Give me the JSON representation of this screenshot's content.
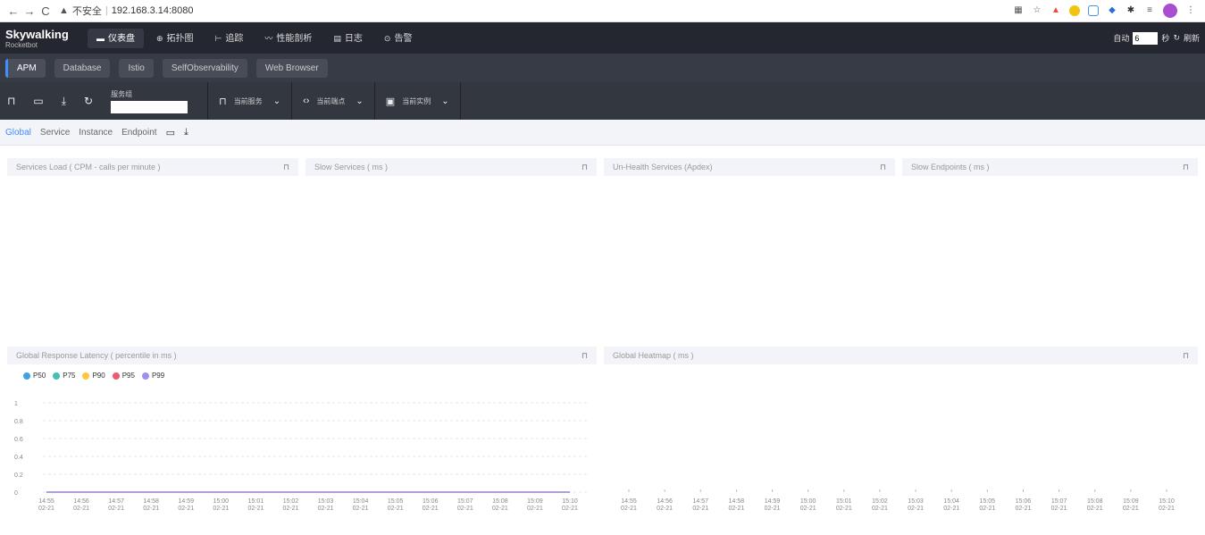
{
  "browser": {
    "back": "←",
    "forward": "→",
    "reload": "C",
    "warning": "▲",
    "insecure_label": "不安全",
    "separator": "|",
    "url": "192.168.3.14:8080"
  },
  "header": {
    "logo_main": "Skywalking",
    "logo_sub": "Rocketbot",
    "nav": [
      {
        "label": "仪表盘",
        "icon": "▬"
      },
      {
        "label": "拓扑图",
        "icon": "⊕"
      },
      {
        "label": "追踪",
        "icon": "⊢"
      },
      {
        "label": "性能剖析",
        "icon": "〰"
      },
      {
        "label": "日志",
        "icon": "▤"
      },
      {
        "label": "告警",
        "icon": "⊙"
      }
    ],
    "auto_label": "自动",
    "auto_value": "6",
    "seconds_label": "秒",
    "refresh_label": "刷新",
    "refresh_icon": "↻"
  },
  "layers": [
    "APM",
    "Database",
    "Istio",
    "SelfObservability",
    "Web Browser"
  ],
  "toolbar": {
    "service_group_label": "服务组",
    "current_service": "当前服务",
    "current_endpoint": "当前端点",
    "current_instance": "当前实例"
  },
  "sub_tabs": [
    "Global",
    "Service",
    "Instance",
    "Endpoint"
  ],
  "panels": {
    "services_load": "Services Load ( CPM - calls per minute )",
    "slow_services": "Slow Services ( ms )",
    "unhealth_services": "Un-Health Services (Apdex)",
    "slow_endpoints": "Slow Endpoints ( ms )",
    "global_latency": "Global Response Latency ( percentile in ms )",
    "global_heatmap": "Global Heatmap ( ms )"
  },
  "chart_data": [
    {
      "type": "line",
      "title": "Global Response Latency ( percentile in ms )",
      "categories": [
        "14:55\n02-21",
        "14:56\n02-21",
        "14:57\n02-21",
        "14:58\n02-21",
        "14:59\n02-21",
        "15:00\n02-21",
        "15:01\n02-21",
        "15:02\n02-21",
        "15:03\n02-21",
        "15:04\n02-21",
        "15:05\n02-21",
        "15:06\n02-21",
        "15:07\n02-21",
        "15:08\n02-21",
        "15:09\n02-21",
        "15:10\n02-21"
      ],
      "x_times": [
        "14:55",
        "14:56",
        "14:57",
        "14:58",
        "14:59",
        "15:00",
        "15:01",
        "15:02",
        "15:03",
        "15:04",
        "15:05",
        "15:06",
        "15:07",
        "15:08",
        "15:09",
        "15:10"
      ],
      "x_dates": [
        "02-21",
        "02-21",
        "02-21",
        "02-21",
        "02-21",
        "02-21",
        "02-21",
        "02-21",
        "02-21",
        "02-21",
        "02-21",
        "02-21",
        "02-21",
        "02-21",
        "02-21",
        "02-21"
      ],
      "y_ticks": [
        "0",
        "0.2",
        "0.4",
        "0.6",
        "0.8",
        "1"
      ],
      "ylim": [
        0,
        1
      ],
      "series": [
        {
          "name": "P50",
          "color": "#3fa1e6",
          "values": [
            0,
            0,
            0,
            0,
            0,
            0,
            0,
            0,
            0,
            0,
            0,
            0,
            0,
            0,
            0,
            0
          ]
        },
        {
          "name": "P75",
          "color": "#3fc1b8",
          "values": [
            0,
            0,
            0,
            0,
            0,
            0,
            0,
            0,
            0,
            0,
            0,
            0,
            0,
            0,
            0,
            0
          ]
        },
        {
          "name": "P90",
          "color": "#ffc53d",
          "values": [
            0,
            0,
            0,
            0,
            0,
            0,
            0,
            0,
            0,
            0,
            0,
            0,
            0,
            0,
            0,
            0
          ]
        },
        {
          "name": "P95",
          "color": "#f05a6e",
          "values": [
            0,
            0,
            0,
            0,
            0,
            0,
            0,
            0,
            0,
            0,
            0,
            0,
            0,
            0,
            0,
            0
          ]
        },
        {
          "name": "P99",
          "color": "#a18ff0",
          "values": [
            0,
            0,
            0,
            0,
            0,
            0,
            0,
            0,
            0,
            0,
            0,
            0,
            0,
            0,
            0,
            0
          ]
        }
      ],
      "grid": true,
      "legend": "top-left"
    },
    {
      "type": "heatmap",
      "title": "Global Heatmap ( ms )",
      "x_times": [
        "14:55",
        "14:56",
        "14:57",
        "14:58",
        "14:59",
        "15:00",
        "15:01",
        "15:02",
        "15:03",
        "15:04",
        "15:05",
        "15:06",
        "15:07",
        "15:08",
        "15:09",
        "15:10"
      ],
      "x_dates": [
        "02-21",
        "02-21",
        "02-21",
        "02-21",
        "02-21",
        "02-21",
        "02-21",
        "02-21",
        "02-21",
        "02-21",
        "02-21",
        "02-21",
        "02-21",
        "02-21",
        "02-21",
        "02-21"
      ],
      "values": []
    }
  ],
  "colors": {
    "accent": "#448dfe",
    "header_bg": "#242730",
    "layer_bg": "#373b45",
    "toolbar_bg": "#333740"
  }
}
